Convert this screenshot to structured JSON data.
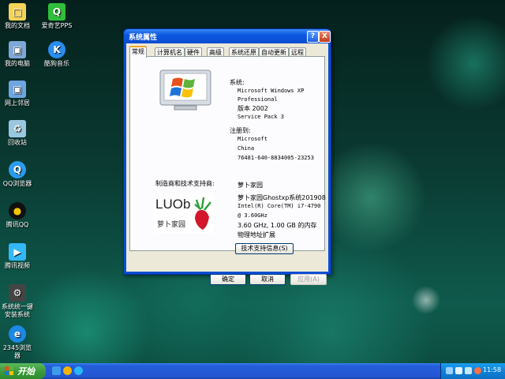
{
  "desktop_icons": [
    {
      "label": "我的文档",
      "icon": "folder-icon",
      "color": "#f3d35a"
    },
    {
      "label": "爱奇艺PPS",
      "icon": "iqiyi-icon",
      "color": "#2fbf3a"
    },
    {
      "label": "我的电脑",
      "icon": "computer-icon",
      "color": "#7fa8d8"
    },
    {
      "label": "酷狗音乐",
      "icon": "kugou-icon",
      "color": "#2a8cf0"
    },
    {
      "label": "网上邻居",
      "icon": "network-icon",
      "color": "#6fa6e0"
    },
    {
      "label": "回收站",
      "icon": "recycle-bin-icon",
      "color": "#9ac7e0"
    },
    {
      "label": "QQ浏览器",
      "icon": "qq-browser-icon",
      "color": "#2a9cf0"
    },
    {
      "label": "腾讯QQ",
      "icon": "qq-penguin-icon",
      "color": "#111111"
    },
    {
      "label": "腾讯视频",
      "icon": "tencent-video-icon",
      "color": "#33b8f5"
    },
    {
      "label": "系统统一键安装系统",
      "icon": "system-install-icon",
      "color": "#444444"
    },
    {
      "label": "2345浏览器",
      "icon": "browser-2345-icon",
      "color": "#1e88e5"
    }
  ],
  "window": {
    "title": "系统属性",
    "help_glyph": "?",
    "close_glyph": "X",
    "tabs": [
      "常规",
      "计算机名",
      "硬件",
      "高级",
      "系统还原",
      "自动更新",
      "远程"
    ],
    "active_tab": "常规",
    "system": {
      "heading": "系统:",
      "os": "Microsoft Windows XP",
      "edition": "Professional",
      "version": "版本 2002",
      "service_pack": "Service Pack 3"
    },
    "registered": {
      "heading": "注册到:",
      "company": "Microsoft",
      "country": "China",
      "product_id": "76481-640-8834005-23253"
    },
    "manufacturer": {
      "heading": "制造商和技术支持商:",
      "name": "萝卜家园",
      "build": "萝卜家园Ghostxp系统201908",
      "cpu": "Intel(R) Core(TM) i7-4790",
      "cpu_speed": "@ 3.60GHz",
      "memory": "3.60 GHz, 1.00 GB 的内存",
      "pae": "物理地址扩展",
      "support_button": "技术支持信息(S)"
    },
    "logo": {
      "text": "LUOb",
      "subtitle": "萝卜家园"
    },
    "buttons": {
      "ok": "确定",
      "cancel": "取消",
      "apply": "应用(A)"
    }
  },
  "taskbar": {
    "start_label": "开始",
    "clock": "11:58",
    "accent": "#245edb"
  }
}
